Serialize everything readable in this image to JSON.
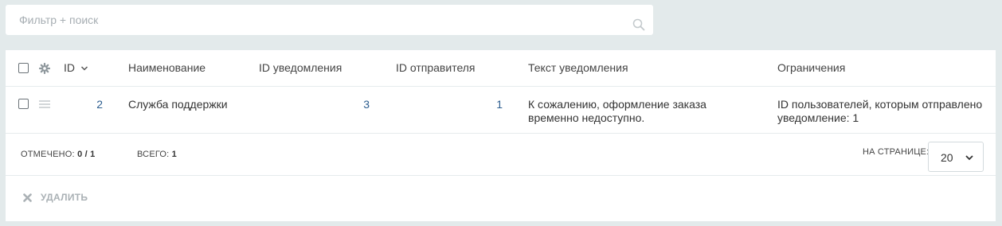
{
  "search": {
    "placeholder": "Фильтр + поиск"
  },
  "table": {
    "columns": {
      "id": "ID",
      "name": "Наименование",
      "notification_id": "ID уведомления",
      "sender_id": "ID отправителя",
      "text": "Текст уведомления",
      "limits": "Ограничения"
    },
    "rows": [
      {
        "id": "2",
        "name": "Служба поддержки",
        "notification_id": "3",
        "sender_id": "1",
        "text": "К сожалению, оформление заказа временно недоступно.",
        "limits": "ID пользователей, которым отправлено уведомление: 1"
      }
    ]
  },
  "footer": {
    "selected_label": "ОТМЕЧЕНО:",
    "selected_value": "0 / 1",
    "total_label": "ВСЕГО:",
    "total_value": "1",
    "per_page_label": "НА СТРАНИЦЕ:",
    "per_page_value": "20"
  },
  "actions": {
    "delete_label": "УДАЛИТЬ"
  },
  "icons": {
    "search": "search-icon",
    "settings": "gear-icon",
    "sort": "chevron-down-icon",
    "drag": "drag-handle-icon",
    "delete": "close-icon"
  },
  "colors": {
    "link": "#2c5d8f",
    "background": "#e3eaeb",
    "muted": "#aab1b5"
  }
}
